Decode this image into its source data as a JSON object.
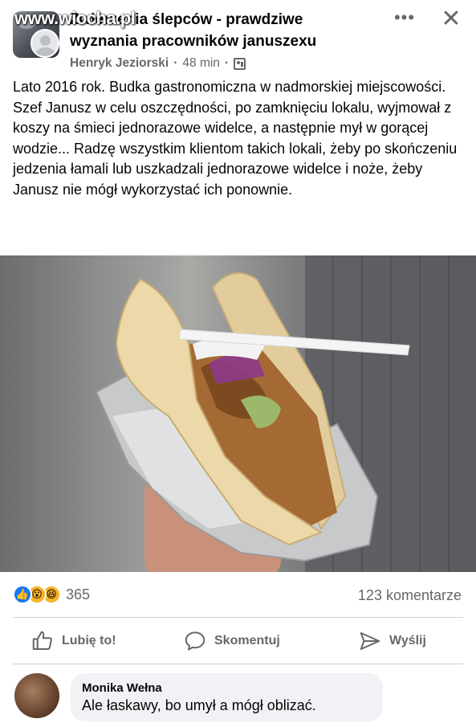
{
  "header": {
    "group_title": "Zwierzenia ślepców - prawdziwe wyznania pracowników januszexu",
    "watermark": "www.wiocha.pl",
    "author": "Henryk Jeziorski",
    "separator": "·",
    "time": "48 min",
    "more_icon": "more-horizontal-icon",
    "close_icon": "close-icon",
    "privacy_icon": "group-members-icon"
  },
  "post": {
    "text": "Lato 2016 rok. Budka gastronomiczna w nadmorskiej miejscowości. Szef Janusz w celu oszczędności, po zamknięciu lokalu, wyjmował z koszy na śmieci jednorazowe widelce, a następnie mył w gorącej wodzie... Radzę wszystkim klientom takich lokali, żeby po skończeniu jedzenia łamali lub uszkadzali jednorazowe widelce i noże, żeby Janusz nie mógł wykorzystać ich ponownie."
  },
  "stats": {
    "reaction_count": "365",
    "comment_count": "123 komentarze",
    "reaction_icons": [
      "like-icon",
      "wow-icon",
      "haha-icon"
    ]
  },
  "actions": {
    "like_label": "Lubię to!",
    "comment_label": "Skomentuj",
    "share_label": "Wyślij"
  },
  "comment": {
    "author": "Monika Wełna",
    "text": "Ale łaskawy, bo umył a mógł oblizać."
  },
  "colors": {
    "accent": "#1877f2",
    "secondary_text": "#65676b",
    "bubble": "#f0f2f5"
  }
}
